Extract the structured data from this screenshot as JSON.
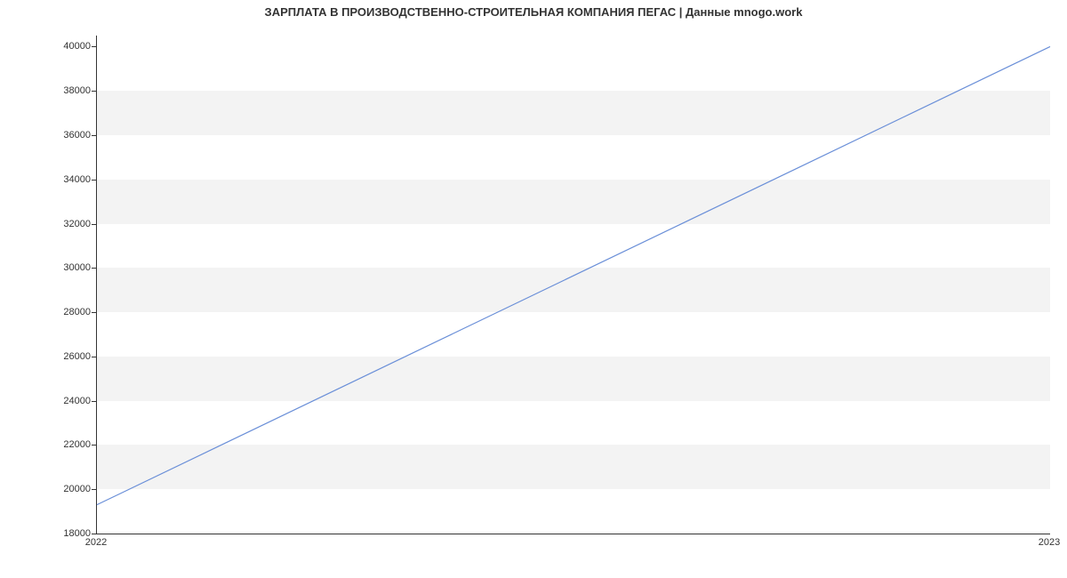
{
  "chart_data": {
    "type": "line",
    "title": "ЗАРПЛАТА В ПРОИЗВОДСТВЕННО-СТРОИТЕЛЬНАЯ КОМПАНИЯ ПЕГАС | Данные mnogo.work",
    "xlabel": "",
    "ylabel": "",
    "x": [
      2022,
      2023
    ],
    "values": [
      19300,
      40000
    ],
    "x_ticks": [
      2022,
      2023
    ],
    "y_ticks": [
      18000,
      20000,
      22000,
      24000,
      26000,
      28000,
      30000,
      32000,
      34000,
      36000,
      38000,
      40000
    ],
    "xlim": [
      2022,
      2023
    ],
    "ylim": [
      18000,
      40500
    ],
    "line_color": "#6a8fd8",
    "grid_bands": true
  }
}
